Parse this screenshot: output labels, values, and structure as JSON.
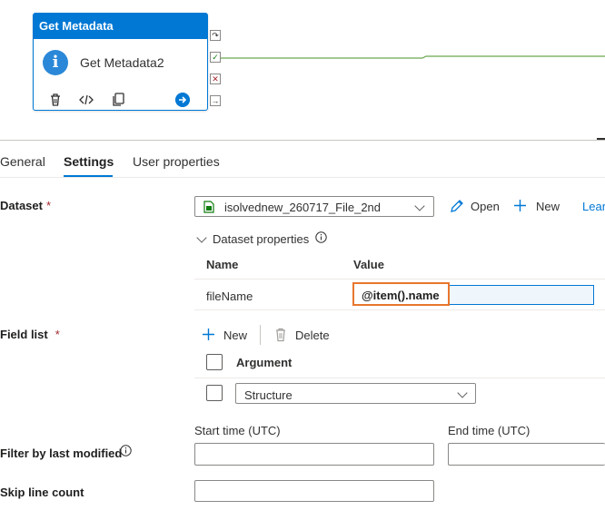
{
  "canvas": {
    "activity": {
      "header": "Get Metadata",
      "name": "Get Metadata2",
      "info_icon": "i"
    }
  },
  "tabs": [
    {
      "label": "General"
    },
    {
      "label": "Settings"
    },
    {
      "label": "User properties"
    }
  ],
  "dataset": {
    "label": "Dataset",
    "required": "*",
    "value": "isolvednew_260717_File_2nd",
    "open_label": "Open",
    "new_label": "New",
    "learn_label": "Lear"
  },
  "dataset_properties": {
    "toggle_label": "Dataset properties",
    "columns": [
      "Name",
      "Value"
    ],
    "rows": [
      {
        "name": "fileName",
        "value": "@item().name"
      }
    ]
  },
  "field_list": {
    "label": "Field list",
    "required": "*",
    "new_label": "New",
    "delete_label": "Delete",
    "header": "Argument",
    "rows": [
      {
        "value": "Structure"
      }
    ]
  },
  "filter": {
    "label": "Filter by last modified",
    "start_label": "Start time (UTC)",
    "end_label": "End time (UTC)",
    "start_value": "",
    "end_value": ""
  },
  "skip": {
    "label": "Skip line count",
    "value": ""
  },
  "colors": {
    "accent": "#0078d4",
    "highlight": "#e8762d",
    "success": "#107c10",
    "error": "#a4262c"
  }
}
